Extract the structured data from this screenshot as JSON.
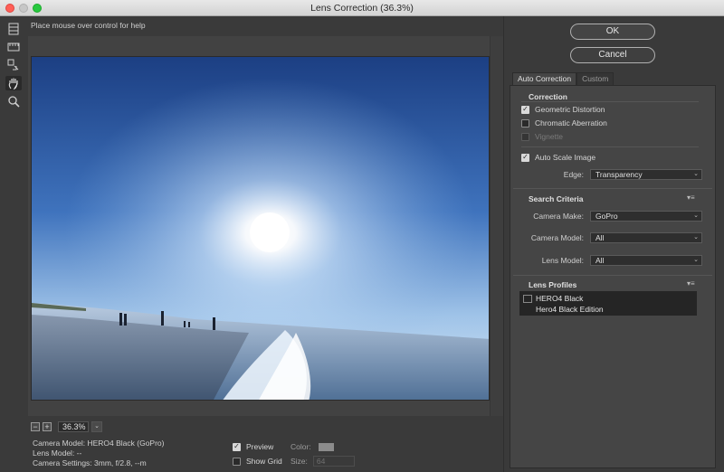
{
  "window": {
    "title": "Lens Correction (36.3%)"
  },
  "help_text": "Place mouse over control for help",
  "tools": [
    {
      "name": "remove-distortion-tool"
    },
    {
      "name": "straighten-tool"
    },
    {
      "name": "move-grid-tool"
    },
    {
      "name": "hand-tool"
    },
    {
      "name": "zoom-tool"
    }
  ],
  "zoom": {
    "minus": "−",
    "plus": "+",
    "value": "36.3%",
    "dropdown": "⌄"
  },
  "info": {
    "camera_model": "Camera Model: HERO4 Black (GoPro)",
    "lens_model": "Lens Model: --",
    "camera_settings": "Camera Settings: 3mm, f/2.8, --m"
  },
  "options": {
    "preview_label": "Preview",
    "preview_checked": true,
    "show_grid_label": "Show Grid",
    "show_grid_checked": false,
    "color_label": "Color:",
    "size_label": "Size:",
    "size_value": "64"
  },
  "buttons": {
    "ok": "OK",
    "cancel": "Cancel"
  },
  "tabs": [
    "Auto Correction",
    "Custom"
  ],
  "correction": {
    "heading": "Correction",
    "geometric_distortion": "Geometric Distortion",
    "chromatic_aberration": "Chromatic Aberration",
    "vignette": "Vignette",
    "auto_scale": "Auto Scale Image",
    "edge_label": "Edge:",
    "edge_value": "Transparency"
  },
  "search": {
    "heading": "Search Criteria",
    "camera_make_label": "Camera Make:",
    "camera_make_value": "GoPro",
    "camera_model_label": "Camera Model:",
    "camera_model_value": "All",
    "lens_model_label": "Lens Model:",
    "lens_model_value": "All"
  },
  "profiles": {
    "heading": "Lens Profiles",
    "items": [
      "HERO4 Black",
      "Hero4 Black Edition"
    ]
  },
  "colors": {
    "accent_swatch": "#8c8c8c"
  }
}
